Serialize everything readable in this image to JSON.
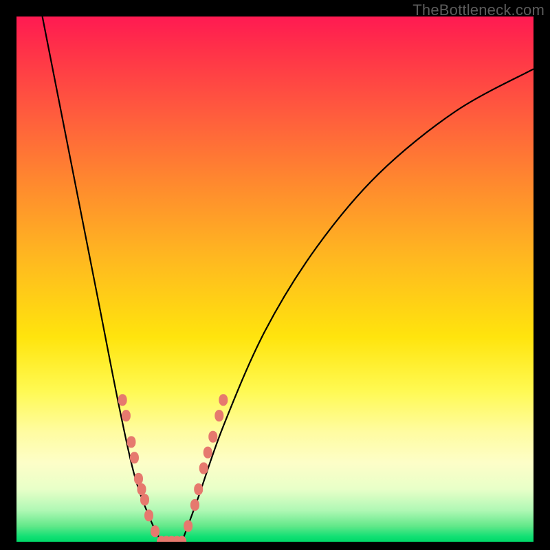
{
  "watermark": "TheBottleneck.com",
  "chart_data": {
    "type": "line",
    "title": "",
    "xlabel": "",
    "ylabel": "",
    "xlim": [
      0,
      100
    ],
    "ylim": [
      0,
      100
    ],
    "grid": false,
    "background_gradient": {
      "direction": "top-to-bottom",
      "stops": [
        {
          "pos": 0,
          "color": "#ff1a52"
        },
        {
          "pos": 18,
          "color": "#ff5a3e"
        },
        {
          "pos": 46,
          "color": "#ffb820"
        },
        {
          "pos": 71,
          "color": "#fff950"
        },
        {
          "pos": 90,
          "color": "#e8ffc8"
        },
        {
          "pos": 100,
          "color": "#00d868"
        }
      ]
    },
    "series": [
      {
        "name": "left-curve",
        "color": "#000000",
        "type": "line",
        "points": [
          {
            "x": 5,
            "y": 100
          },
          {
            "x": 8,
            "y": 85
          },
          {
            "x": 12,
            "y": 65
          },
          {
            "x": 16,
            "y": 45
          },
          {
            "x": 20,
            "y": 25
          },
          {
            "x": 23,
            "y": 12
          },
          {
            "x": 26,
            "y": 4
          },
          {
            "x": 28,
            "y": 0
          }
        ]
      },
      {
        "name": "right-curve",
        "color": "#000000",
        "type": "line",
        "points": [
          {
            "x": 32,
            "y": 0
          },
          {
            "x": 35,
            "y": 8
          },
          {
            "x": 40,
            "y": 22
          },
          {
            "x": 48,
            "y": 40
          },
          {
            "x": 58,
            "y": 56
          },
          {
            "x": 70,
            "y": 70
          },
          {
            "x": 85,
            "y": 82
          },
          {
            "x": 100,
            "y": 90
          }
        ]
      }
    ],
    "markers": {
      "name": "fit-dots",
      "color": "#e6796e",
      "type": "scatter",
      "points": [
        {
          "x": 20.5,
          "y": 27
        },
        {
          "x": 21.2,
          "y": 24
        },
        {
          "x": 22.2,
          "y": 19
        },
        {
          "x": 22.8,
          "y": 16
        },
        {
          "x": 23.6,
          "y": 12
        },
        {
          "x": 24.2,
          "y": 10
        },
        {
          "x": 24.8,
          "y": 8
        },
        {
          "x": 25.6,
          "y": 5
        },
        {
          "x": 26.8,
          "y": 2
        },
        {
          "x": 28.0,
          "y": 0
        },
        {
          "x": 29.0,
          "y": 0
        },
        {
          "x": 30.0,
          "y": 0
        },
        {
          "x": 31.0,
          "y": 0
        },
        {
          "x": 32.0,
          "y": 0
        },
        {
          "x": 33.2,
          "y": 3
        },
        {
          "x": 34.5,
          "y": 7
        },
        {
          "x": 35.2,
          "y": 10
        },
        {
          "x": 36.2,
          "y": 14
        },
        {
          "x": 37.0,
          "y": 17
        },
        {
          "x": 38.0,
          "y": 20
        },
        {
          "x": 39.2,
          "y": 24
        },
        {
          "x": 40.0,
          "y": 27
        }
      ]
    }
  }
}
